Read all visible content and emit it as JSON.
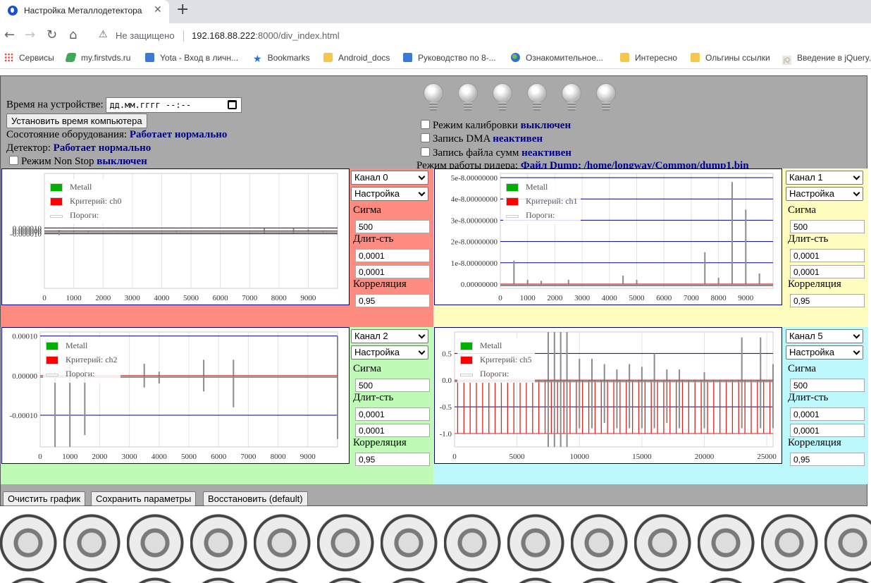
{
  "browser": {
    "tab_title": "Настройка Металлодетектора",
    "tab_close": "✕",
    "new_tab": "+",
    "back": "←",
    "forward": "→",
    "reload": "↻",
    "home": "⌂",
    "security_label": "Не защищено",
    "url_host": "192.168.88.222",
    "url_rest": ":8000/div_index.html",
    "bookmarks": [
      {
        "label": "Сервисы",
        "icon": "apps-icon"
      },
      {
        "label": "my.firstvds.ru",
        "icon": "firstvds-icon"
      },
      {
        "label": "Yota - Вход в личн...",
        "icon": "yota-icon"
      },
      {
        "label": "Bookmarks",
        "icon": "star-icon"
      },
      {
        "label": "Android_docs",
        "icon": "folder-icon"
      },
      {
        "label": "Руководство по 8-...",
        "icon": "hourglass-icon"
      },
      {
        "label": "Ознакомительное...",
        "icon": "globe-icon"
      },
      {
        "label": "Интересно",
        "icon": "folder-icon"
      },
      {
        "label": "Ольгины ссылки",
        "icon": "folder-icon"
      },
      {
        "label": "Введение в jQuery...",
        "icon": "jquery-icon"
      }
    ]
  },
  "device": {
    "time_label": "Время на устройстве:",
    "time_value": "дд.мм.гггг --:--",
    "set_time_button": "Установить время компьютера",
    "equipment_label": "Сосотояние оборудования:",
    "equipment_value": "Работает нормально",
    "detector_label": "Детектор:",
    "detector_value": "Работает нормально",
    "nonstop_label": "Режим Non Stop",
    "nonstop_value": "выключен"
  },
  "modes": {
    "calibration_label": "Режим калибровки",
    "calibration_value": "выключен",
    "dma_label": "Запись DMA",
    "dma_value": "неактивен",
    "sums_label": "Запись файла сумм",
    "sums_value": "неактивен",
    "reader_label": "Режим работы ридера:",
    "reader_value": "Файл Dump: /home/longway/Common/dump1.bin"
  },
  "legend": {
    "metall": "Metall",
    "criterion_prefix": "Критерий:",
    "thresholds": "Пороги:"
  },
  "params": {
    "setup": "Настройка",
    "sigma_label": "Сигма",
    "duration_label": "Длит-сть",
    "correlation_label": "Корреляция"
  },
  "channels": [
    {
      "channel": "Канал 0",
      "criterion": "ch0",
      "sigma": "500",
      "dur1": "0,0001",
      "dur2": "0,0001",
      "corr": "0,95",
      "bg": "#fd8b80"
    },
    {
      "channel": "Канал 1",
      "criterion": "ch1",
      "sigma": "500",
      "dur1": "0,0001",
      "dur2": "0,0001",
      "corr": "0,95",
      "bg": "#fffdbd"
    },
    {
      "channel": "Канал 2",
      "criterion": "ch2",
      "sigma": "500",
      "dur1": "0,0001",
      "dur2": "0,0001",
      "corr": "0,95",
      "bg": "#bffbb7"
    },
    {
      "channel": "Канал 5",
      "criterion": "ch5",
      "sigma": "500",
      "dur1": "0,0001",
      "dur2": "0,0001",
      "corr": "0,95",
      "bg": "#bdf8fd"
    }
  ],
  "chart_data": [
    {
      "type": "line",
      "series": [
        {
          "name": "Metall"
        },
        {
          "name": "Критерий: ch0"
        },
        {
          "name": "Пороги:"
        }
      ],
      "xlim": [
        0,
        10000
      ],
      "xticks": [
        "0",
        "1000",
        "2000",
        "3000",
        "4000",
        "5000",
        "6000",
        "7000",
        "8000",
        "9000"
      ],
      "ylim": [
        -0.0002,
        0.0002
      ],
      "yticks": [
        {
          "v": 1e-05,
          "label": "0.000010"
        },
        {
          "v": 0,
          "label": "0.000000"
        },
        {
          "v": -1e-05,
          "label": "-0.000010"
        }
      ],
      "spikes": [
        [
          500,
          -1.5e-05,
          3e-06
        ],
        [
          1000,
          -6e-06,
          2e-06
        ],
        [
          1500,
          -2e-06,
          1.5e-06
        ],
        [
          2500,
          -1.5e-06,
          1.5e-06
        ],
        [
          4500,
          -2e-06,
          2e-06
        ],
        [
          5000,
          -1.5e-06,
          1.5e-06
        ],
        [
          5500,
          -1.5e-06,
          1.5e-06
        ],
        [
          7500,
          -9e-06,
          9e-06
        ],
        [
          8500,
          -9e-06,
          9e-06
        ],
        [
          9000,
          -5e-06,
          5e-06
        ],
        [
          9500,
          -2e-06,
          1.5e-06
        ]
      ]
    },
    {
      "type": "line",
      "series": [
        {
          "name": "Metall"
        },
        {
          "name": "Критерий: ch1"
        },
        {
          "name": "Пороги:"
        }
      ],
      "xlim": [
        0,
        10000
      ],
      "xticks": [
        "0",
        "1000",
        "2000",
        "3000",
        "4000",
        "5000",
        "6000",
        "7000",
        "8000",
        "9000"
      ],
      "ylim": [
        -2e-09,
        5.2e-08
      ],
      "yticks": [
        {
          "v": 5e-08,
          "label": "5e-8.00000000"
        },
        {
          "v": 4e-08,
          "label": "4e-8.00000000"
        },
        {
          "v": 3e-08,
          "label": "3e-8.00000000"
        },
        {
          "v": 2e-08,
          "label": "2e-8.00000000"
        },
        {
          "v": 1e-08,
          "label": "1e-8.00000000"
        },
        {
          "v": 0,
          "label": "0.00000000"
        }
      ],
      "spikes": [
        [
          500,
          0,
          1.1e-08
        ],
        [
          1000,
          0,
          2e-09
        ],
        [
          1500,
          0,
          1.5e-09
        ],
        [
          2500,
          0,
          2e-09
        ],
        [
          4500,
          0,
          4e-09
        ],
        [
          5000,
          0,
          2e-09
        ],
        [
          7500,
          0,
          1.5e-08
        ],
        [
          8000,
          0,
          3e-09
        ],
        [
          8500,
          0,
          4.8e-08
        ],
        [
          9000,
          0,
          3.5e-08
        ],
        [
          9500,
          0,
          5e-09
        ]
      ]
    },
    {
      "type": "line",
      "series": [
        {
          "name": "Metall"
        },
        {
          "name": "Критерий: ch2"
        },
        {
          "name": "Пороги:"
        }
      ],
      "xlim": [
        0,
        10000
      ],
      "xticks": [
        "0",
        "1000",
        "2000",
        "3000",
        "4000",
        "5000",
        "6000",
        "7000",
        "8000",
        "9000"
      ],
      "ylim": [
        -0.00018,
        0.00011
      ],
      "yticks": [
        {
          "v": 0.0001,
          "label": "0.00010"
        },
        {
          "v": 0,
          "label": "0.00000"
        },
        {
          "v": -0.0001,
          "label": "-0.00010"
        }
      ],
      "spikes": [
        [
          500,
          -0.00018,
          1e-05
        ],
        [
          1000,
          -0.00018,
          3e-05
        ],
        [
          1500,
          -0.00015,
          2e-05
        ],
        [
          3500,
          -3e-05,
          3e-05
        ],
        [
          4000,
          -2e-05,
          1e-05
        ],
        [
          5500,
          -4e-05,
          4e-05
        ],
        [
          6500,
          -8e-05,
          4e-05
        ],
        [
          10000,
          -0.00016,
          0.0001
        ]
      ]
    },
    {
      "type": "line",
      "series": [
        {
          "name": "Metall"
        },
        {
          "name": "Критерий: ch5"
        },
        {
          "name": "Пороги:"
        }
      ],
      "xlim": [
        0,
        25500
      ],
      "xticks": [
        "0",
        "5000",
        "10000",
        "15000",
        "20000",
        "25000"
      ],
      "ylim": [
        -1.25,
        0.9
      ],
      "yticks": [
        {
          "v": 0.5,
          "label": "0.5"
        },
        {
          "v": 0,
          "label": "0.0"
        },
        {
          "v": -0.5,
          "label": "-0.5"
        },
        {
          "v": -1,
          "label": "-1.0"
        }
      ],
      "thresholds": [
        0.5,
        -0.5
      ],
      "spikes": [
        [
          7500,
          -1.25,
          0.9
        ],
        [
          8000,
          -1.25,
          0.9
        ],
        [
          8500,
          -1.25,
          0.9
        ],
        [
          9000,
          -1.25,
          0.9
        ],
        [
          10000,
          -0.9,
          0.4
        ],
        [
          11000,
          -0.9,
          0.4
        ],
        [
          12000,
          -0.8,
          0.3
        ],
        [
          13000,
          -0.9,
          0.2
        ],
        [
          14000,
          -0.9,
          0.3
        ],
        [
          15000,
          -0.9,
          0.25
        ],
        [
          16000,
          -0.9,
          0.5
        ],
        [
          17000,
          -0.8,
          0.2
        ],
        [
          18000,
          -0.9,
          0.2
        ],
        [
          20000,
          -0.9,
          0.15
        ],
        [
          23000,
          -0.9,
          0.8
        ],
        [
          24500,
          -0.9,
          0.8
        ],
        [
          25500,
          -0.9,
          0.3
        ]
      ],
      "criterion_x": [
        250,
        750,
        1250,
        1750,
        2250,
        2750,
        3250,
        3750,
        4250,
        4750,
        5250,
        5750,
        6250,
        6750,
        7250,
        7750,
        8250,
        8750,
        9250,
        9750,
        10250,
        10750,
        11250,
        11750,
        12250,
        12750,
        13250,
        13750,
        14250,
        14750,
        15250,
        15750,
        16250,
        16750,
        17250,
        17750,
        18250,
        18750,
        19250,
        19750,
        20250,
        20750,
        21250,
        21750,
        22250,
        22750,
        23250,
        23750,
        24250,
        24750,
        25250
      ]
    }
  ],
  "buttons": {
    "clear": "Очистить график",
    "save": "Сохранить параметры",
    "restore": "Восстановить (default)"
  }
}
